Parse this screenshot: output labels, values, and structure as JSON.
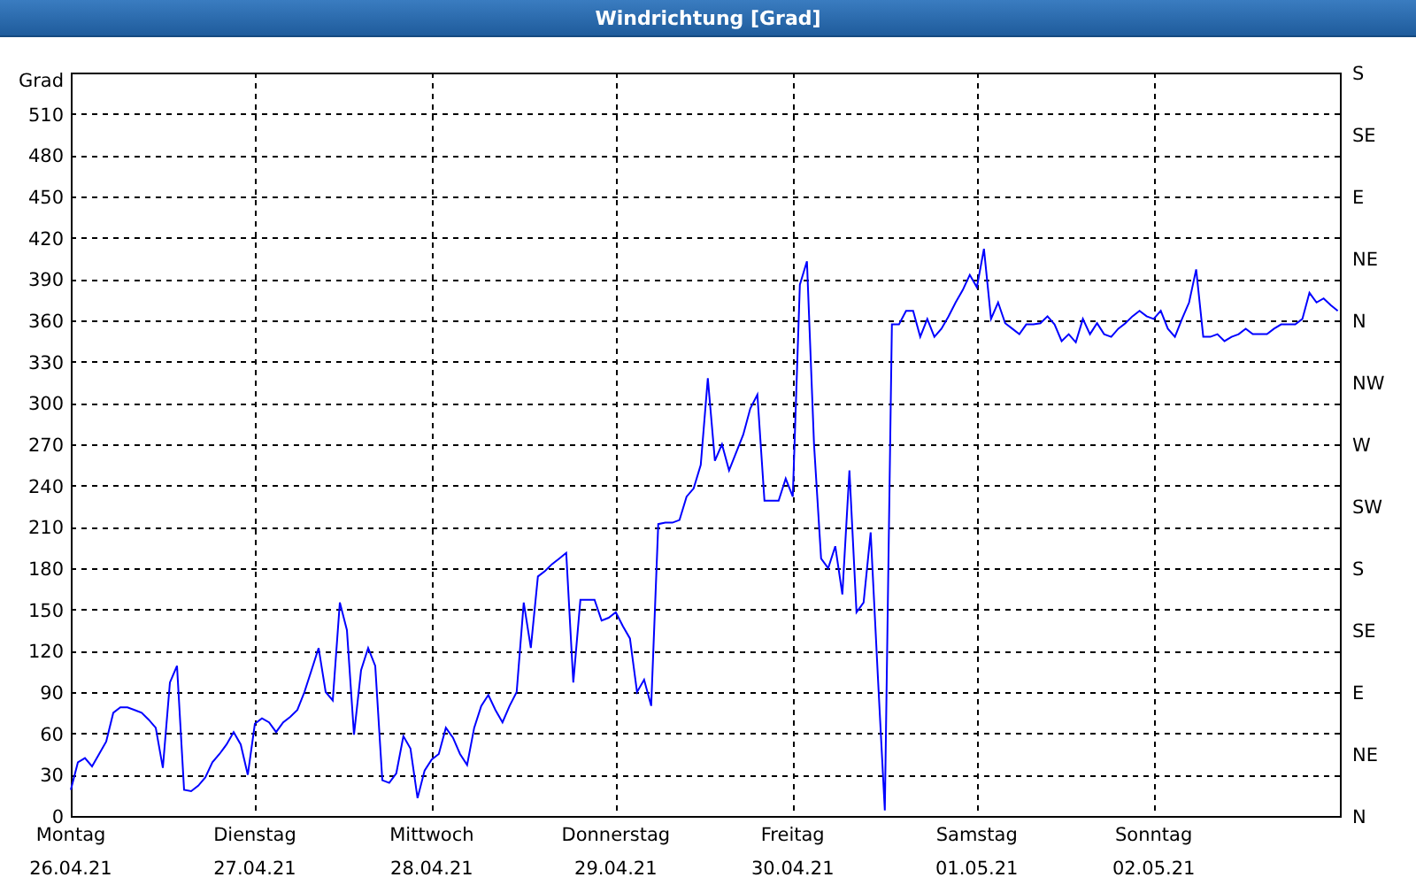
{
  "window": {
    "title": "Windrichtung [Grad]"
  },
  "chart": {
    "dates": [
      "26.04.21",
      "27.04.21",
      "28.04.21",
      "29.04.21",
      "30.04.21",
      "01.05.21",
      "02.05.21"
    ],
    "right_ticks": [
      "S",
      "SE",
      "E",
      "NE",
      "N",
      "NW",
      "W",
      "SW",
      "S",
      "SE",
      "E",
      "NE",
      "N"
    ],
    "chart_data": {
      "type": "line",
      "grid": true,
      "ylabel": "Grad",
      "ylim": [
        0,
        540
      ],
      "yticks": [
        0,
        30,
        60,
        90,
        120,
        150,
        180,
        210,
        240,
        270,
        300,
        330,
        360,
        390,
        420,
        450,
        480,
        510
      ],
      "categories": [
        "Montag",
        null,
        null,
        null,
        null,
        null,
        null,
        null,
        null,
        null,
        null,
        null,
        null,
        null,
        null,
        null,
        null,
        null,
        null,
        null,
        null,
        null,
        null,
        null,
        null,
        null,
        "Dienstag",
        null,
        null,
        null,
        null,
        null,
        null,
        null,
        null,
        null,
        null,
        null,
        null,
        null,
        null,
        null,
        null,
        null,
        null,
        null,
        null,
        null,
        null,
        null,
        null,
        "Mittwoch",
        null,
        null,
        null,
        null,
        null,
        null,
        null,
        null,
        null,
        null,
        null,
        null,
        null,
        null,
        null,
        null,
        null,
        null,
        null,
        null,
        null,
        null,
        null,
        null,
        null,
        "Donnerstag",
        null,
        null,
        null,
        null,
        null,
        null,
        null,
        null,
        null,
        null,
        null,
        null,
        null,
        null,
        null,
        null,
        null,
        null,
        null,
        null,
        null,
        null,
        null,
        null,
        "Freitag",
        null,
        null,
        null,
        null,
        null,
        null,
        null,
        null,
        null,
        null,
        null,
        null,
        null,
        null,
        null,
        null,
        null,
        null,
        null,
        null,
        null,
        null,
        null,
        null,
        null,
        "Samstag",
        null,
        null,
        null,
        null,
        null,
        null,
        null,
        null,
        null,
        null,
        null,
        null,
        null,
        null,
        null,
        null,
        null,
        null,
        null,
        null,
        null,
        null,
        null,
        null,
        "Sonntag",
        null,
        null,
        null,
        null,
        null,
        null,
        null,
        null,
        null,
        null,
        null,
        null,
        null,
        null,
        null,
        null,
        null,
        null,
        null,
        null,
        null,
        null,
        null,
        null,
        null,
        null
      ],
      "series": [
        {
          "color": "#0000ff",
          "values": [
            19,
            39,
            42,
            36,
            45,
            54,
            75,
            79,
            79,
            77,
            75,
            70,
            64,
            35,
            97,
            109,
            19,
            18,
            22,
            28,
            39,
            45,
            52,
            61,
            52,
            30,
            67,
            71,
            68,
            61,
            68,
            72,
            77,
            90,
            106,
            122,
            90,
            84,
            155,
            135,
            59,
            106,
            122,
            109,
            26,
            24,
            31,
            58,
            49,
            13,
            33,
            41,
            45,
            64,
            57,
            45,
            37,
            64,
            80,
            88,
            77,
            68,
            80,
            90,
            155,
            122,
            174,
            178,
            183,
            187,
            191,
            97,
            157,
            157,
            157,
            142,
            144,
            148,
            138,
            129,
            90,
            99,
            80,
            212,
            213,
            213,
            215,
            232,
            238,
            255,
            318,
            258,
            270,
            251,
            264,
            277,
            296,
            306,
            229,
            229,
            229,
            245,
            232,
            386,
            403,
            270,
            187,
            180,
            196,
            161,
            251,
            148,
            155,
            206,
            103,
            4,
            357,
            357,
            367,
            367,
            348,
            361,
            348,
            354,
            363,
            373,
            382,
            393,
            384,
            412,
            361,
            373,
            358,
            354,
            350,
            357,
            357,
            358,
            363,
            357,
            345,
            350,
            344,
            361,
            350,
            358,
            350,
            348,
            354,
            358,
            363,
            367,
            363,
            361,
            367,
            354,
            348,
            361,
            373,
            397,
            348,
            348,
            350,
            345,
            348,
            350,
            354,
            350,
            350,
            350,
            354,
            357,
            357,
            357,
            361,
            380,
            373,
            376,
            371,
            367
          ]
        }
      ]
    }
  }
}
